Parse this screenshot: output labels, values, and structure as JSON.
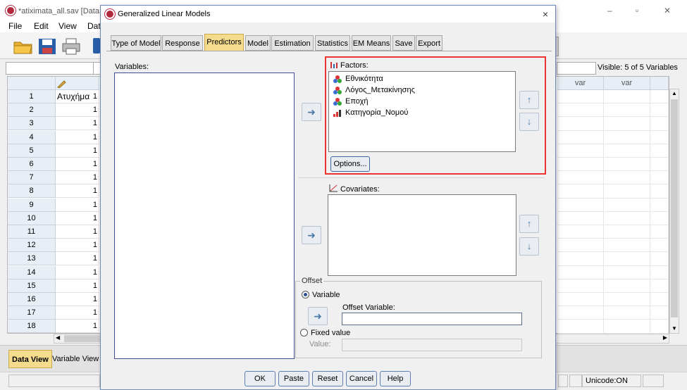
{
  "bg": {
    "title": "*atiximata_all.sav [DataSet",
    "menu": [
      "File",
      "Edit",
      "View",
      "Dat"
    ],
    "visible": "Visible: 5 of 5 Variables",
    "first_col_header": "Ατυχήμα",
    "var_headers": [
      "var",
      "var"
    ],
    "rows": [
      "1",
      "2",
      "3",
      "4",
      "5",
      "6",
      "7",
      "8",
      "9",
      "10",
      "11",
      "12",
      "13",
      "14",
      "15",
      "16",
      "17",
      "18"
    ],
    "cell_value": "1",
    "tab_data_view": "Data View",
    "tab_variable_view": "Variable View",
    "status_unicode": "Unicode:ON",
    "window_min": "–",
    "window_max": "▫",
    "window_close": "✕"
  },
  "dialog": {
    "title": "Generalized Linear Models",
    "close": "×",
    "tabs": [
      "Type of Model",
      "Response",
      "Predictors",
      "Model",
      "Estimation",
      "Statistics",
      "EM Means",
      "Save",
      "Export"
    ],
    "active_tab": "Predictors",
    "variables_label": "Variables:",
    "factors_label": "Factors:",
    "factors": [
      {
        "name": "Εθνικότητα",
        "icon": "nominal-icon"
      },
      {
        "name": "Λόγος_Μετακίνησης",
        "icon": "nominal-icon"
      },
      {
        "name": "Εποχή",
        "icon": "nominal-icon"
      },
      {
        "name": "Κατηγορία_Νομού",
        "icon": "ordinal-icon"
      }
    ],
    "options_button": "Options...",
    "covariates_label": "Covariates:",
    "offset": {
      "legend": "Offset",
      "variable_radio": "Variable",
      "offset_variable_label": "Offset Variable:",
      "fixed_radio": "Fixed value",
      "value_label": "Value:",
      "selected": "Variable"
    },
    "buttons": {
      "ok": "OK",
      "paste": "Paste",
      "reset": "Reset",
      "cancel": "Cancel",
      "help": "Help"
    }
  },
  "colors": {
    "accent_tab": "#f4dc8c",
    "highlight_border": "#e33333",
    "title_bar": "#ffffff"
  }
}
